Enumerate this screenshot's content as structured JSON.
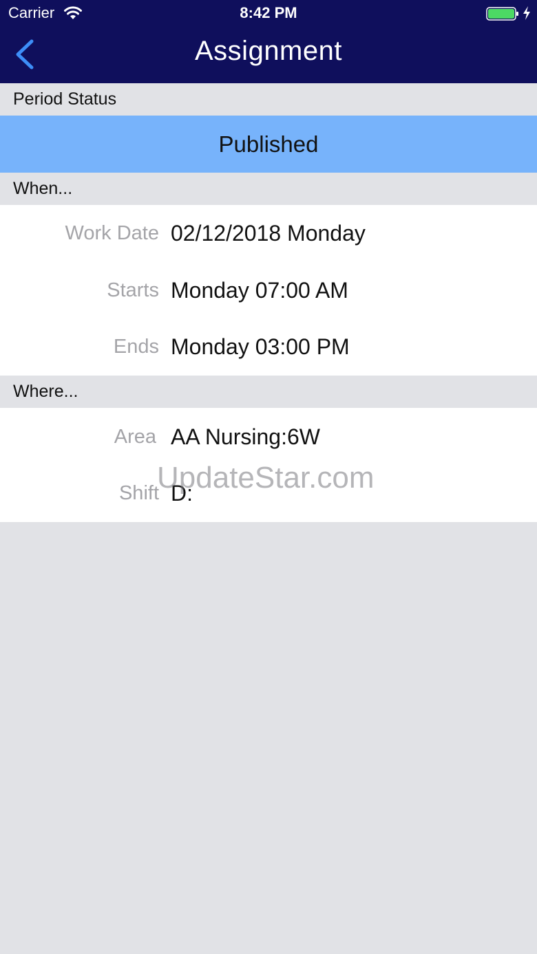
{
  "status_bar": {
    "carrier": "Carrier",
    "time": "8:42 PM",
    "battery_color": "#4cd964"
  },
  "nav": {
    "title": "Assignment",
    "back_icon": "chevron-left-icon",
    "bar_color": "#0f0f5c"
  },
  "period_status": {
    "header": "Period Status",
    "value": "Published",
    "value_color": "#77b3fb"
  },
  "when": {
    "header": "When...",
    "rows": [
      {
        "label": "Work Date",
        "value": "02/12/2018 Monday"
      },
      {
        "label": "Starts",
        "value": "Monday 07:00 AM"
      },
      {
        "label": "Ends",
        "value": "Monday 03:00 PM"
      }
    ]
  },
  "where": {
    "header": "Where...",
    "rows": [
      {
        "label": "Area",
        "value": "AA Nursing:6W"
      },
      {
        "label": "Shift",
        "value": "D:"
      }
    ]
  },
  "watermark": "UpdateStar.com"
}
